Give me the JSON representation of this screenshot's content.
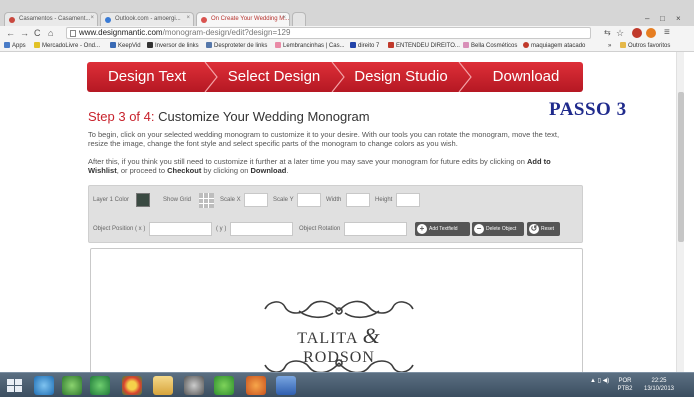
{
  "browser": {
    "tabs": [
      {
        "label": "Casamentos - Casament...",
        "active": false
      },
      {
        "label": "Outlook.com - amoergi...",
        "active": false
      },
      {
        "label": "On Create Your Wedding M...",
        "active": true
      }
    ],
    "url_host": "www.designmantic.com",
    "url_path": "/monogram-design/edit?design=129",
    "bookmarks": [
      {
        "label": "Apps",
        "icon_color": "#4a7cc7"
      },
      {
        "label": "MercadoLivre - Ond...",
        "icon_color": "#e2c227"
      },
      {
        "label": "KeepVid",
        "icon_color": "#3a6bb5"
      },
      {
        "label": "Inversor de links",
        "icon_color": "#333333"
      },
      {
        "label": "Desproteter de links",
        "icon_color": "#5577aa"
      },
      {
        "label": "Lembrancinhas | Cas...",
        "icon_color": "#e98aa6"
      },
      {
        "label": "direito 7",
        "icon_color": "#2244aa"
      },
      {
        "label": "ENTENDEU DIREITO...",
        "icon_color": "#c0392b"
      },
      {
        "label": "Bella Cosméticos",
        "icon_color": "#d88fb8"
      },
      {
        "label": "maquiagem atacado",
        "icon_color": "#c0392b"
      },
      {
        "label": "»",
        "icon_color": ""
      },
      {
        "label": "Outros favoritos",
        "icon_color": "#e5b84a"
      }
    ]
  },
  "steps": [
    "Design Text",
    "Select Design",
    "Design Studio",
    "Download"
  ],
  "annotation": "PASSO 3",
  "heading": {
    "prefix": "Step 3 of 4: ",
    "title": "Customize Your Wedding Monogram"
  },
  "paragraph1": "To begin, click on your selected wedding monogram to customize it to your desire. With our tools you can rotate the monogram, move the text, resize the image, change the font style and select specific parts of the monogram to change colors as you wish.",
  "paragraph2": {
    "t1": "After this, if you think you still need to customize it further at a later time you may save your monogram for future edits by clicking on ",
    "b1": "Add to Wishlist",
    "t2": ", or proceed to ",
    "b2": "Checkout",
    "t3": " by clicking on ",
    "b3": "Download",
    "t4": "."
  },
  "toolbar": {
    "layer_color_label": "Layer 1 Color",
    "layer_color": "#3a4a42",
    "show_grid_label": "Show Grid",
    "scale_x_label": "Scale X",
    "scale_y_label": "Scale Y",
    "width_label": "Width",
    "height_label": "Height",
    "object_position_label": "Object Position ( x )",
    "y_label": "( y )",
    "object_rotation_label": "Object Rotation",
    "add_textfield": "Add Textfield",
    "delete_object": "Delete Object",
    "reset": "Reset"
  },
  "monogram": {
    "name_left": "TALITA",
    "amp": "&",
    "name_right": "RODSON"
  },
  "taskbar": {
    "time": "22:25",
    "date": "13/10/2013",
    "lang": "POR PTB2"
  },
  "colors": {
    "accent_red": "#c8232d",
    "annotation_blue": "#1f2a8c"
  }
}
